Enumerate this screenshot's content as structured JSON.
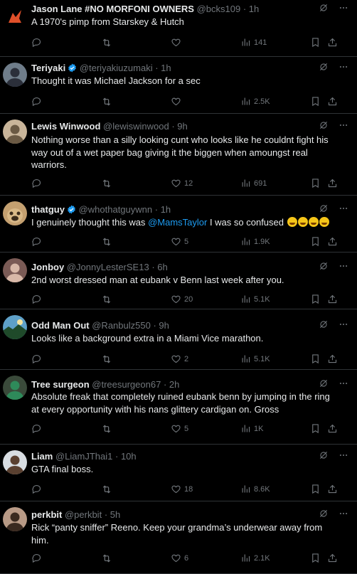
{
  "tweets": [
    {
      "name": "Jason Lane #NO MORFONI OWNERS",
      "handle": "@bcks109",
      "time": "· 1h",
      "verified": false,
      "text": "A 1970's pimp from Starskey & Hutch",
      "replies": "",
      "retweets": "",
      "likes": "",
      "views": "141",
      "avatar": {
        "bg": "#000000",
        "fg": "#e0502a",
        "icon": "fox-logo-avatar"
      }
    },
    {
      "name": "Teriyaki",
      "handle": "@teriyakiuzumaki",
      "time": "· 1h",
      "verified": true,
      "text": "Thought it was Michael Jackson for a sec",
      "replies": "",
      "retweets": "",
      "likes": "",
      "views": "2.5K",
      "avatar": {
        "bg": "#6f7d8a",
        "fg": "#2b2f3a",
        "icon": "person-avatar"
      }
    },
    {
      "name": "Lewis Winwood",
      "handle": "@lewiswinwood",
      "time": "· 9h",
      "verified": false,
      "text": "Nothing worse than a silly looking cunt who looks like he couldnt fight his way out of a wet paper bag giving it the biggen when amoungst real warriors.",
      "replies": "",
      "retweets": "",
      "likes": "12",
      "views": "691",
      "avatar": {
        "bg": "#c9b59a",
        "fg": "#6b5a44",
        "icon": "person-avatar"
      }
    },
    {
      "name": "thatguy",
      "handle": "@whothatguywnn",
      "time": "· 1h",
      "verified": true,
      "text_before": "I genuinely thought this was ",
      "mention": "@MamsTaylor",
      "text_after": " I was so confused",
      "emoji_count": 4,
      "replies": "",
      "retweets": "",
      "likes": "5",
      "views": "1.9K",
      "avatar": {
        "bg": "#c4a070",
        "fg": "#3a2a1a",
        "icon": "pug-avatar"
      }
    },
    {
      "name": "Jonboy",
      "handle": "@JonnyLesterSE13",
      "time": "· 6h",
      "verified": false,
      "text": "2nd worst dressed man at eubank v Benn last week after you.",
      "replies": "",
      "retweets": "",
      "likes": "20",
      "views": "5.1K",
      "avatar": {
        "bg": "#7a5a55",
        "fg": "#d8b8a8",
        "icon": "person-avatar"
      }
    },
    {
      "name": "Odd Man Out",
      "handle": "@Ranbulz550",
      "time": "· 9h",
      "verified": false,
      "text": "Looks like a background extra in a Miami Vice marathon.",
      "replies": "",
      "retweets": "",
      "likes": "2",
      "views": "5.1K",
      "avatar": {
        "bg": "#5ea0c8",
        "fg": "#1f4a2a",
        "icon": "landscape-avatar"
      }
    },
    {
      "name": "Tree surgeon",
      "handle": "@treesurgeon67",
      "time": "· 2h",
      "verified": false,
      "text": "Absolute freak that completely ruined eubank benn by jumping in the ring at every opportunity with his nans glittery cardigan on. Gross",
      "replies": "",
      "retweets": "",
      "likes": "5",
      "views": "1K",
      "avatar": {
        "bg": "#3a4a3a",
        "fg": "#2e8a5a",
        "icon": "person-avatar"
      }
    },
    {
      "name": "Liam",
      "handle": "@LiamJThai1",
      "time": "· 10h",
      "verified": false,
      "text": "GTA final boss.",
      "replies": "",
      "retweets": "",
      "likes": "18",
      "views": "8.6K",
      "avatar": {
        "bg": "#d8dde2",
        "fg": "#5a4030",
        "icon": "person-avatar"
      }
    },
    {
      "name": "perkbit",
      "handle": "@perkbit",
      "time": "· 5h",
      "verified": false,
      "text": "Rick “panty sniffer” Reeno. Keep your grandma’s underwear away from him.",
      "replies": "",
      "retweets": "",
      "likes": "6",
      "views": "2.1K",
      "avatar": {
        "bg": "#b89a86",
        "fg": "#3a2a20",
        "icon": "person-avatar"
      }
    }
  ],
  "colors": {
    "background": "#000000",
    "text": "#e7e9ea",
    "muted": "#71767b",
    "divider": "#2f3336",
    "accent": "#1d9bf0"
  }
}
